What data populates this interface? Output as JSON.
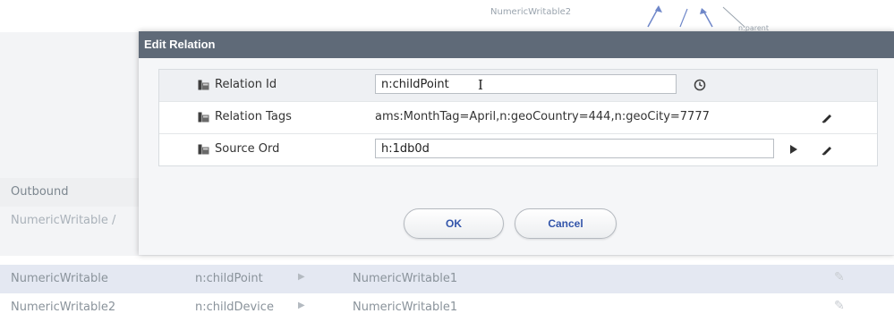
{
  "background": {
    "graph_node_label": "NumericWritable2",
    "graph_edge_label": "n:parent",
    "section_label": "Outbound",
    "partial_row_text": "NumericWritable /",
    "rows": [
      {
        "source": "NumericWritable",
        "relation": "n:childPoint",
        "target": "NumericWritable1"
      },
      {
        "source": "NumericWritable2",
        "relation": "n:childDevice",
        "target": "NumericWritable1"
      }
    ]
  },
  "modal": {
    "title": "Edit Relation",
    "fields": {
      "relation_id": {
        "label": "Relation Id",
        "value": "n:childPoint"
      },
      "relation_tags": {
        "label": "Relation Tags",
        "value": "ams:MonthTag=April,n:geoCountry=444,n:geoCity=7777"
      },
      "source_ord": {
        "label": "Source Ord",
        "value": "h:1db0d"
      }
    },
    "ok_label": "OK",
    "cancel_label": "Cancel"
  },
  "colors": {
    "header_bg": "#5f6a78",
    "button_text": "#3355aa",
    "selected_row_bg": "#e4e8f2"
  }
}
